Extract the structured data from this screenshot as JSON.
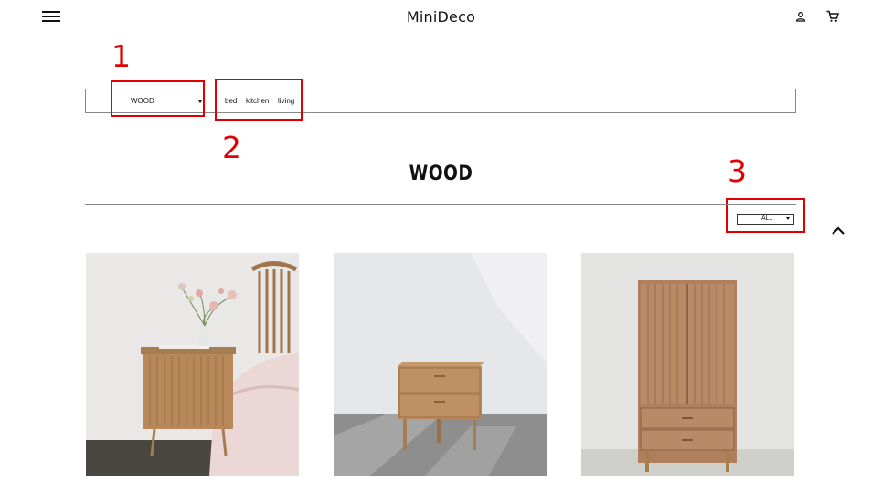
{
  "header": {
    "brand": "MiniDeco",
    "menu_icon": "hamburger-menu-icon",
    "user_icon": "user-icon",
    "cart_icon": "cart-icon"
  },
  "filter": {
    "category_selected": "WOOD",
    "tags": [
      "bed",
      "kitchen",
      "living"
    ]
  },
  "annotations": [
    "1",
    "2",
    "3"
  ],
  "page": {
    "title": "WOOD",
    "sort_selected": "ALL"
  },
  "colors": {
    "annotation": "#e00000",
    "text": "#111111"
  },
  "products": [
    {
      "image": "wooden-bedside-cabinet-with-flowers"
    },
    {
      "image": "wooden-two-drawer-nightstand"
    },
    {
      "image": "wooden-wardrobe"
    }
  ]
}
